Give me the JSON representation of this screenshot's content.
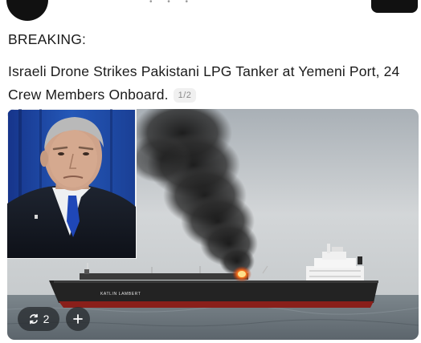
{
  "post": {
    "label": "BREAKING:",
    "headline": "Israeli Drone Strikes Pakistani LPG Tanker at Yemeni Port, 24 Crew Members Onboard.",
    "page_indicator": "1/2"
  },
  "image": {
    "ship_name": "KATLIN LAMBERT",
    "repost_count": "2",
    "add_label": "+"
  },
  "colors": {
    "sky": "#c9cdd0",
    "sea": "#6d7880",
    "smoke": "#1f1f1f",
    "hull": "#232323",
    "hull_red": "#8a1f1a",
    "fire": "#f06a1a",
    "inset_bg": "#1d4fa8",
    "overlay": "#2c3034"
  }
}
